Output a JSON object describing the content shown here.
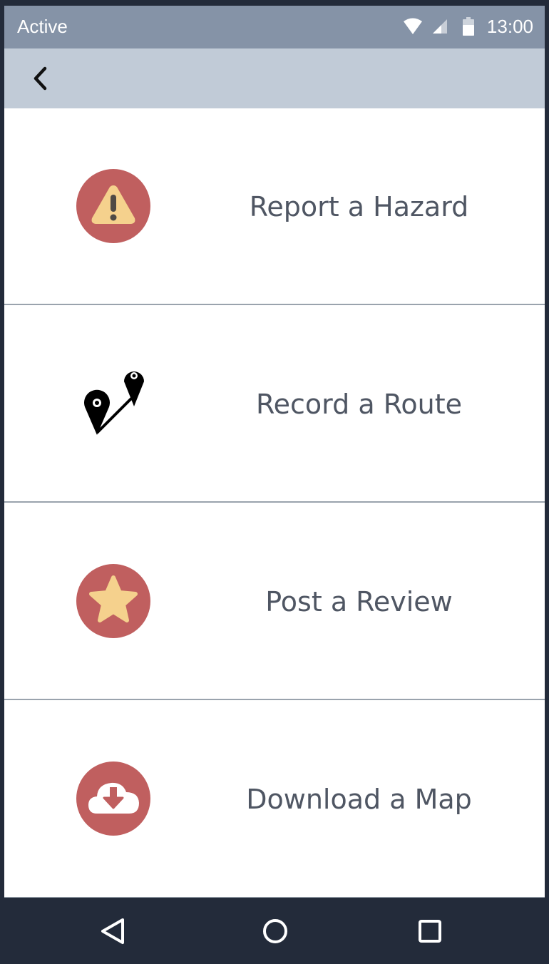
{
  "status_bar": {
    "label": "Active",
    "time": "13:00",
    "icons": [
      "wifi-icon",
      "signal-icon",
      "battery-icon"
    ]
  },
  "app_bar": {
    "back_icon": "chevron-left-icon"
  },
  "menu": {
    "items": [
      {
        "label": "Report a Hazard",
        "icon": "warning-icon"
      },
      {
        "label": "Record a Route",
        "icon": "route-pins-icon"
      },
      {
        "label": "Post a Review",
        "icon": "star-icon"
      },
      {
        "label": "Download a Map",
        "icon": "cloud-download-icon"
      }
    ]
  },
  "nav_bar": {
    "icons": [
      "back-triangle-icon",
      "home-circle-icon",
      "recents-square-icon"
    ]
  },
  "colors": {
    "status_bar": "#8593a7",
    "app_bar": "#c1cbd7",
    "icon_circle": "#c05f5f",
    "icon_accent": "#f5d18d",
    "label_text": "#4f5663",
    "nav_bar": "#232b3a"
  }
}
